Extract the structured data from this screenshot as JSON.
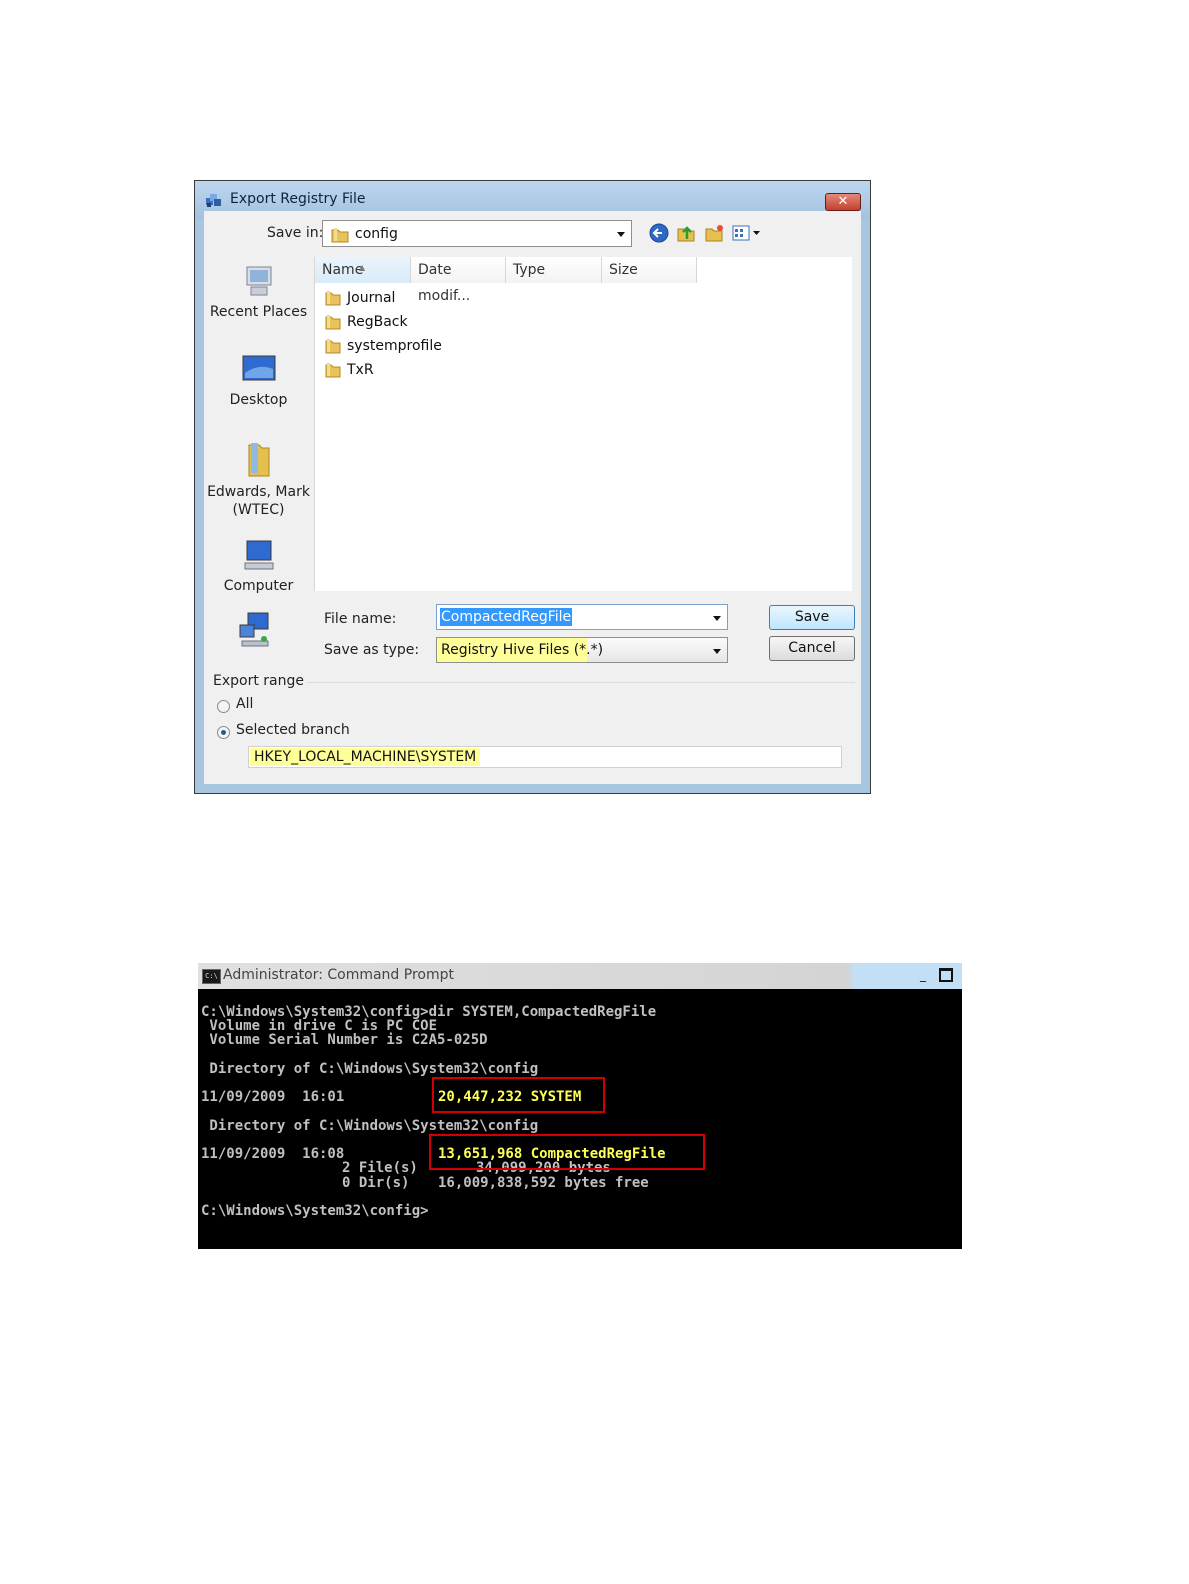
{
  "dialog": {
    "title": "Export Registry File",
    "close_label": "✕",
    "save_in_label": "Save in:",
    "save_in_value": "config",
    "columns": [
      "Name",
      "Date modif...",
      "Type",
      "Size"
    ],
    "places": [
      "Recent Places",
      "Desktop",
      "Edwards, Mark (WTEC)",
      "Computer"
    ],
    "files": [
      "Journal",
      "RegBack",
      "systemprofile",
      "TxR"
    ],
    "file_name_label": "File name:",
    "file_name_value": "CompactedRegFile",
    "save_type_label": "Save as type:",
    "save_type_value": "Registry Hive Files (*.*)",
    "save_button": "Save",
    "cancel_button": "Cancel",
    "export_range_label": "Export range",
    "radio_all_label": "All",
    "radio_selected_label": "Selected branch",
    "selected_radio": "Selected branch",
    "branch_value": "HKEY_LOCAL_MACHINE\\SYSTEM"
  },
  "console": {
    "title": "Administrator: Command Prompt",
    "icon_text": "C:\\",
    "line1": "C:\\Windows\\System32\\config>dir SYSTEM,CompactedRegFile",
    "line2": " Volume in drive C is PC COE",
    "line3": " Volume Serial Number is C2A5-025D",
    "line4": " Directory of C:\\Windows\\System32\\config",
    "line5_date": "11/09/2009  16:01",
    "line5_file": "20,447,232 SYSTEM",
    "line6": " Directory of C:\\Windows\\System32\\config",
    "line7_date": "11/09/2009  16:08",
    "line7_file": "13,651,968 CompactedRegFile",
    "line8_count": "2 File(s)",
    "line8_bytes": "34,099,200 bytes",
    "line9_count": "0 Dir(s)",
    "line9_bytes": "16,009,838,592 bytes free",
    "line10": "C:\\Windows\\System32\\config>"
  },
  "colors": {
    "highlight_yellow": "#ffff99",
    "console_yellow": "#ffff55",
    "annotation_red": "#d40000",
    "selection_blue": "#3399ff"
  }
}
